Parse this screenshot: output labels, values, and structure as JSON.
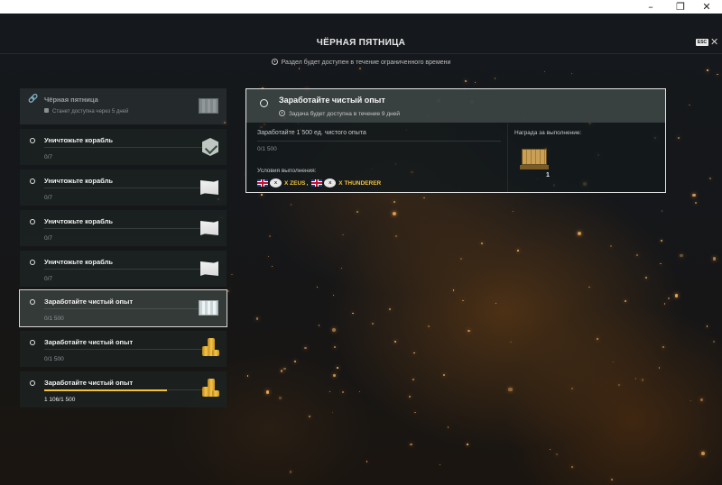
{
  "window": {
    "minimize_glyph": "–",
    "maximize_glyph": "❐",
    "close_glyph": "✕"
  },
  "header": {
    "title": "ЧЁРНАЯ ПЯТНИЦА",
    "subtitle": "Раздел будет доступен в течение ограниченного времени",
    "esc_label": "ESC",
    "close_glyph": "✕"
  },
  "tasks": [
    {
      "title": "Чёрная пятница",
      "sub": "Станет доступна через 5 дней",
      "state": "locked",
      "icon": "scroll-icon"
    },
    {
      "title": "Уничтожьте корабль",
      "count": "0/7",
      "progress": 0,
      "icon": "chevron-badge-icon"
    },
    {
      "title": "Уничтожьте корабль",
      "count": "0/7",
      "progress": 0,
      "icon": "flag-icon"
    },
    {
      "title": "Уничтожьте корабль",
      "count": "0/7",
      "progress": 0,
      "icon": "flag-icon"
    },
    {
      "title": "Уничтожьте корабль",
      "count": "0/7",
      "progress": 0,
      "icon": "flag-icon"
    },
    {
      "title": "Заработайте чистый опыт",
      "count": "0/1 500",
      "progress": 0,
      "state": "selected",
      "icon": "scroll-icon"
    },
    {
      "title": "Заработайте чистый опыт",
      "count": "0/1 500",
      "progress": 0,
      "icon": "coins-icon"
    },
    {
      "title": "Заработайте чистый опыт",
      "count": "1 106/1 500",
      "progress": 0.737,
      "icon": "coins-icon"
    }
  ],
  "detail": {
    "title": "Заработайте чистый опыт",
    "deadline": "Задача будет доступна в течение 9 дней",
    "goal": "Заработайте 1 500 ед. чистого опыта",
    "count": "0/1 500",
    "conditions_label": "Условия выполнения:",
    "conditions": [
      {
        "tier": "X",
        "ship": "X ZEUS",
        "separator": ","
      },
      {
        "tier": "X",
        "ship": "X THUNDERER",
        "separator": ""
      }
    ],
    "reward_label": "Награда за выполнение:",
    "reward_qty": "1",
    "reward_icon": "crate-icon"
  },
  "colors": {
    "accent_gold": "#f2c23c",
    "panel_bg": "#1c2222",
    "selected_border": "#d6d6d6"
  }
}
